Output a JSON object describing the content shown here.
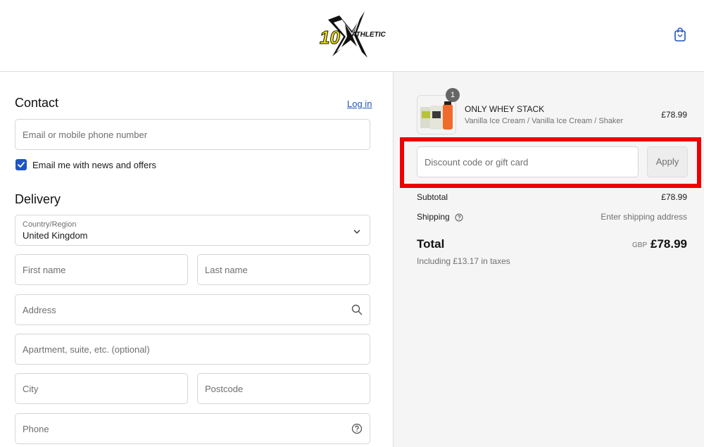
{
  "brand": {
    "logo_number": "10X",
    "logo_word": "ATHLETIC",
    "accent_color": "#1f54c3"
  },
  "header": {
    "cart_icon": "shopping-bag-icon"
  },
  "contact": {
    "title": "Contact",
    "login_link": "Log in",
    "email_placeholder": "Email or mobile phone number",
    "newsletter_label": "Email me with news and offers",
    "newsletter_checked": true
  },
  "delivery": {
    "title": "Delivery",
    "country_label": "Country/Region",
    "country_value": "United Kingdom",
    "first_name_placeholder": "First name",
    "last_name_placeholder": "Last name",
    "address_placeholder": "Address",
    "apartment_placeholder": "Apartment, suite, etc. (optional)",
    "city_placeholder": "City",
    "postcode_placeholder": "Postcode",
    "phone_placeholder": "Phone"
  },
  "cart": {
    "items": [
      {
        "quantity": "1",
        "name": "ONLY WHEY STACK",
        "variant": "Vanilla Ice Cream / Vanilla Ice Cream / Shaker",
        "price": "£78.99"
      }
    ]
  },
  "discount": {
    "placeholder": "Discount code or gift card",
    "apply_label": "Apply",
    "highlight_color": "#ee0000"
  },
  "summary": {
    "subtotal_label": "Subtotal",
    "subtotal_value": "£78.99",
    "shipping_label": "Shipping",
    "shipping_value": "Enter shipping address",
    "total_label": "Total",
    "total_currency": "GBP",
    "total_value": "£78.99",
    "taxes_note": "Including £13.17 in taxes"
  }
}
